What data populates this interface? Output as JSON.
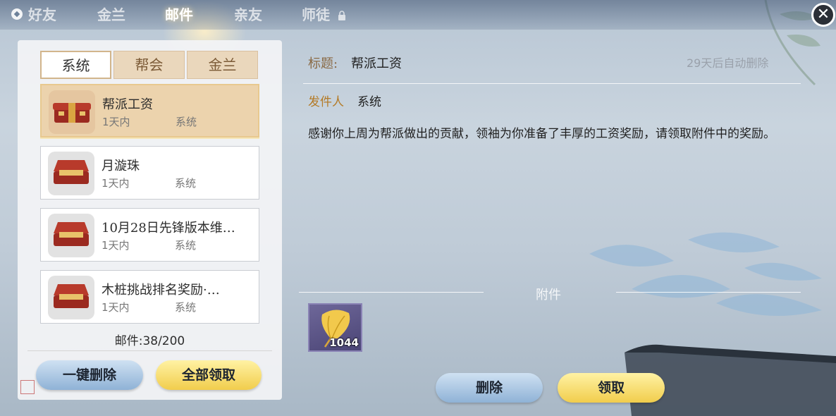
{
  "top_tabs": [
    {
      "label": "好友"
    },
    {
      "label": "金兰"
    },
    {
      "label": "邮件"
    },
    {
      "label": "亲友"
    },
    {
      "label": "师徒"
    }
  ],
  "sub_tabs": [
    {
      "label": "系统"
    },
    {
      "label": "帮会"
    },
    {
      "label": "金兰"
    }
  ],
  "mails": [
    {
      "title": "帮派工资",
      "time": "1天内",
      "sender": "系统"
    },
    {
      "title": "月漩珠",
      "time": "1天内",
      "sender": "系统"
    },
    {
      "title": "10月28日先锋版本维…",
      "time": "1天内",
      "sender": "系统"
    },
    {
      "title": "木桩挑战排名奖励·…",
      "time": "1天内",
      "sender": "系统"
    }
  ],
  "mail_count": "邮件:38/200",
  "buttons": {
    "delete_all": "一键删除",
    "claim_all": "全部领取",
    "delete": "删除",
    "claim": "领取"
  },
  "detail": {
    "title_label": "标题:",
    "title": "帮派工资",
    "expire": "29天后自动删除",
    "sender_label": "发件人",
    "sender": "系统",
    "body": "感谢你上周为帮派做出的贡献，领袖为你准备了丰厚的工资奖励，请领取附件中的奖励。",
    "attachment_label": "附件",
    "attachment_qty": "1044"
  },
  "icons": {
    "close": "close-icon",
    "lock": "lock-icon",
    "mail": "gift-box-icon",
    "attachment": "ginkgo-leaf-icon"
  },
  "colors": {
    "accent_gold": "#f1cd4c",
    "accent_blue": "#8fb2d6",
    "selected_row": "#ecd3ad",
    "sender_label": "#b47a26"
  }
}
